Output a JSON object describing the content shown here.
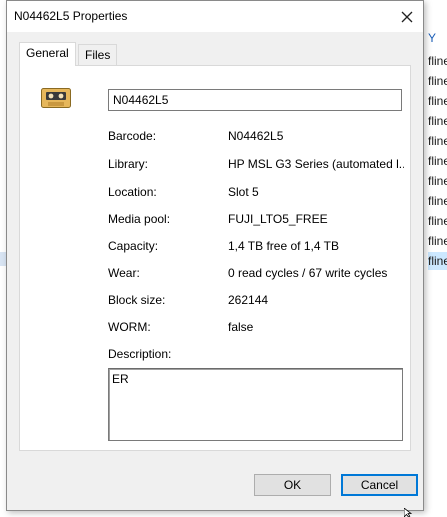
{
  "background_window": {
    "rows": [
      {
        "text": "Y",
        "style": "blue"
      },
      {
        "text": "fline",
        "style": "normal"
      },
      {
        "text": "fline",
        "style": "normal"
      },
      {
        "text": "fline",
        "style": "normal"
      },
      {
        "text": "fline",
        "style": "normal"
      },
      {
        "text": "fline",
        "style": "normal"
      },
      {
        "text": "fline",
        "style": "normal"
      },
      {
        "text": "fline",
        "style": "normal"
      },
      {
        "text": "fline",
        "style": "normal"
      },
      {
        "text": "fline",
        "style": "normal"
      },
      {
        "text": "fline",
        "style": "normal"
      },
      {
        "text": "fline",
        "style": "selected"
      }
    ]
  },
  "dialog": {
    "title": "N04462L5 Properties",
    "close_icon": "close-icon"
  },
  "tabs": [
    {
      "label": "General",
      "active": true
    },
    {
      "label": "Files",
      "active": false
    }
  ],
  "general": {
    "media_icon": "tape-cassette-icon",
    "name_value": "N04462L5",
    "properties": [
      {
        "label": "Barcode:",
        "value": "N04462L5"
      },
      {
        "label": "Library:",
        "value": "HP MSL G3 Series (automated l..."
      },
      {
        "label": "Location:",
        "value": "Slot 5"
      },
      {
        "label": "Media pool:",
        "value": "FUJI_LTO5_FREE"
      },
      {
        "label": "Capacity:",
        "value": "1,4 TB free of 1,4 TB"
      },
      {
        "label": "Wear:",
        "value": "0 read cycles / 67 write cycles"
      },
      {
        "label": "Block size:",
        "value": "262144"
      },
      {
        "label": "WORM:",
        "value": "false"
      }
    ],
    "description_label": "Description:",
    "description_value": "ER"
  },
  "buttons": {
    "ok": "OK",
    "cancel": "Cancel"
  },
  "colors": {
    "accent": "#0078d7",
    "selection": "#cce8ff",
    "cassette_body": "#e6b75b",
    "cassette_dark": "#3a3a3a"
  }
}
